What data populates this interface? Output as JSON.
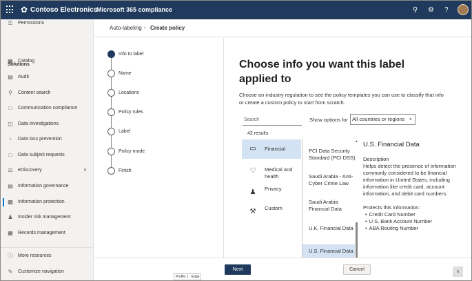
{
  "topbar": {
    "brand": "Contoso Electronics",
    "app_name": "Microsoft 365 compliance",
    "icons": [
      "waffle-icon",
      "contoso-logo-icon",
      "bell-icon",
      "gear-icon",
      "help-icon",
      "avatar"
    ]
  },
  "leftnav": {
    "top_item": {
      "label": "Permissions",
      "icon": "key-icon"
    },
    "section_title": "Solutions",
    "items": [
      {
        "label": "Catalog",
        "icon": "catalog-icon"
      },
      {
        "label": "Audit",
        "icon": "audit-icon"
      },
      {
        "label": "Content search",
        "icon": "search-icon"
      },
      {
        "label": "Communication compliance",
        "icon": "chat-icon"
      },
      {
        "label": "Data investigations",
        "icon": "investigation-icon"
      },
      {
        "label": "Data loss prevention",
        "icon": "shield-icon"
      },
      {
        "label": "Data subject requests",
        "icon": "document-icon"
      },
      {
        "label": "eDiscovery",
        "icon": "ediscovery-icon"
      },
      {
        "label": "Information governance",
        "icon": "archive-icon"
      },
      {
        "label": "Information protection",
        "icon": "protection-icon"
      },
      {
        "label": "Insider risk management",
        "icon": "person-risk-icon"
      },
      {
        "label": "Records management",
        "icon": "records-icon"
      }
    ],
    "bottom_items": [
      {
        "label": "More resources",
        "icon": "info-icon"
      },
      {
        "label": "Customize navigation",
        "icon": "pencil-icon"
      }
    ],
    "active_item": "Information protection"
  },
  "breadcrumb": {
    "parent": "Auto-labeling",
    "separator": "›",
    "current": "Create policy"
  },
  "wizard": {
    "steps": [
      {
        "label": "Info to label",
        "current": true
      },
      {
        "label": "Name",
        "current": false
      },
      {
        "label": "Locations",
        "current": false
      },
      {
        "label": "Policy rules",
        "current": false
      },
      {
        "label": "Label",
        "current": false
      },
      {
        "label": "Policy mode",
        "current": false
      },
      {
        "label": "Finish",
        "current": false
      }
    ]
  },
  "main": {
    "title": "Choose info you want this label applied to",
    "description": "Choose an industry regulation to see the policy templates you can use to classify that info or create a custom policy to start from scratch.",
    "search_placeholder": "Search",
    "show_options_label": "Show options for",
    "region_value": "All countries or regions",
    "results_count": "42 results",
    "categories": [
      {
        "label": "Financial",
        "icon": "card-icon",
        "selected": true
      },
      {
        "label": "Medical and health",
        "icon": "heart-icon",
        "selected": false
      },
      {
        "label": "Privacy",
        "icon": "person-key-icon",
        "selected": false
      },
      {
        "label": "Custom",
        "icon": "wrench-icon",
        "selected": false
      }
    ],
    "templates": [
      {
        "label": "PCI Data Security Standard (PCI DSS)",
        "selected": false
      },
      {
        "label": "Saudi Arabia - Anti-Cyber Crime Law",
        "selected": false
      },
      {
        "label": "Saudi Arabia Financial Data",
        "selected": false
      },
      {
        "label": "U.K. Financial Data",
        "selected": false
      },
      {
        "label": "U.S. Financial Data",
        "selected": true
      }
    ],
    "details": {
      "title": "U.S. Financial Data",
      "description_heading": "Description",
      "description": "Helps detect the presence of information commonly considered to be financial information in United States, including information like credit card, account information, and debit card numbers.",
      "protects_heading": "Protects this information:",
      "protects": [
        "Credit Card Number",
        "U.S. Bank Account Number",
        "ABA Routing Number"
      ]
    }
  },
  "footer": {
    "next_label": "Next",
    "cancel_label": "Cancel",
    "profile_tag": "Profile 1 · Edge"
  }
}
